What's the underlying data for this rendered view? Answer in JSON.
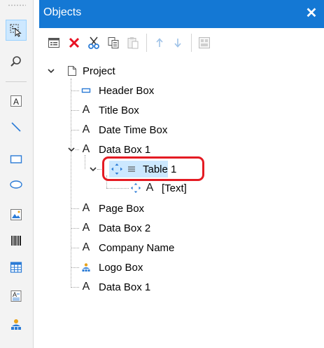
{
  "panel": {
    "title": "Objects",
    "close_glyph": "✕"
  },
  "left_toolbar": [
    {
      "icon": "pointer-select-icon",
      "active": true
    },
    {
      "icon": "zoom-icon"
    },
    {
      "icon": "text-box-icon"
    },
    {
      "icon": "line-icon"
    },
    {
      "icon": "rectangle-icon"
    },
    {
      "icon": "ellipse-icon"
    },
    {
      "icon": "image-icon"
    },
    {
      "icon": "barcode-icon"
    },
    {
      "icon": "table-icon"
    },
    {
      "icon": "rich-text-icon"
    },
    {
      "icon": "data-box-icon"
    }
  ],
  "object_toolbar": [
    {
      "icon": "properties-icon",
      "enabled": true
    },
    {
      "icon": "delete-icon",
      "enabled": true
    },
    {
      "icon": "cut-icon",
      "enabled": true
    },
    {
      "icon": "copy-icon",
      "enabled": true
    },
    {
      "icon": "paste-icon",
      "enabled": false
    },
    {
      "icon": "move-up-icon",
      "enabled": false
    },
    {
      "icon": "move-down-icon",
      "enabled": false
    },
    {
      "icon": "layout-icon",
      "enabled": false
    }
  ],
  "tree": {
    "root": "Project",
    "items": [
      {
        "label": "Header Box",
        "icon": "header-box-icon"
      },
      {
        "label": "Title Box",
        "icon": "text-icon",
        "glyph": "A"
      },
      {
        "label": "Date Time Box",
        "icon": "text-icon",
        "glyph": "A"
      },
      {
        "label": "Data Box 1",
        "icon": "text-icon",
        "glyph": "A",
        "expanded": true
      },
      {
        "label": "Table 1",
        "icon": "table-icon",
        "expanded": true,
        "selected": true
      },
      {
        "label": "[Text]",
        "icon": "text-icon",
        "glyph": "A"
      },
      {
        "label": "Page Box",
        "icon": "text-icon",
        "glyph": "A"
      },
      {
        "label": "Data Box 2",
        "icon": "text-icon",
        "glyph": "A"
      },
      {
        "label": "Company Name",
        "icon": "text-icon",
        "glyph": "A"
      },
      {
        "label": "Logo Box",
        "icon": "logo-icon"
      },
      {
        "label": "Data Box 1",
        "icon": "text-icon",
        "glyph": "A"
      }
    ]
  },
  "colors": {
    "title_bar": "#1478d4",
    "selection": "#cce8ff",
    "highlight_outline": "#e41b23",
    "delete_red": "#e81123",
    "move_blue": "#2b7bd6"
  }
}
